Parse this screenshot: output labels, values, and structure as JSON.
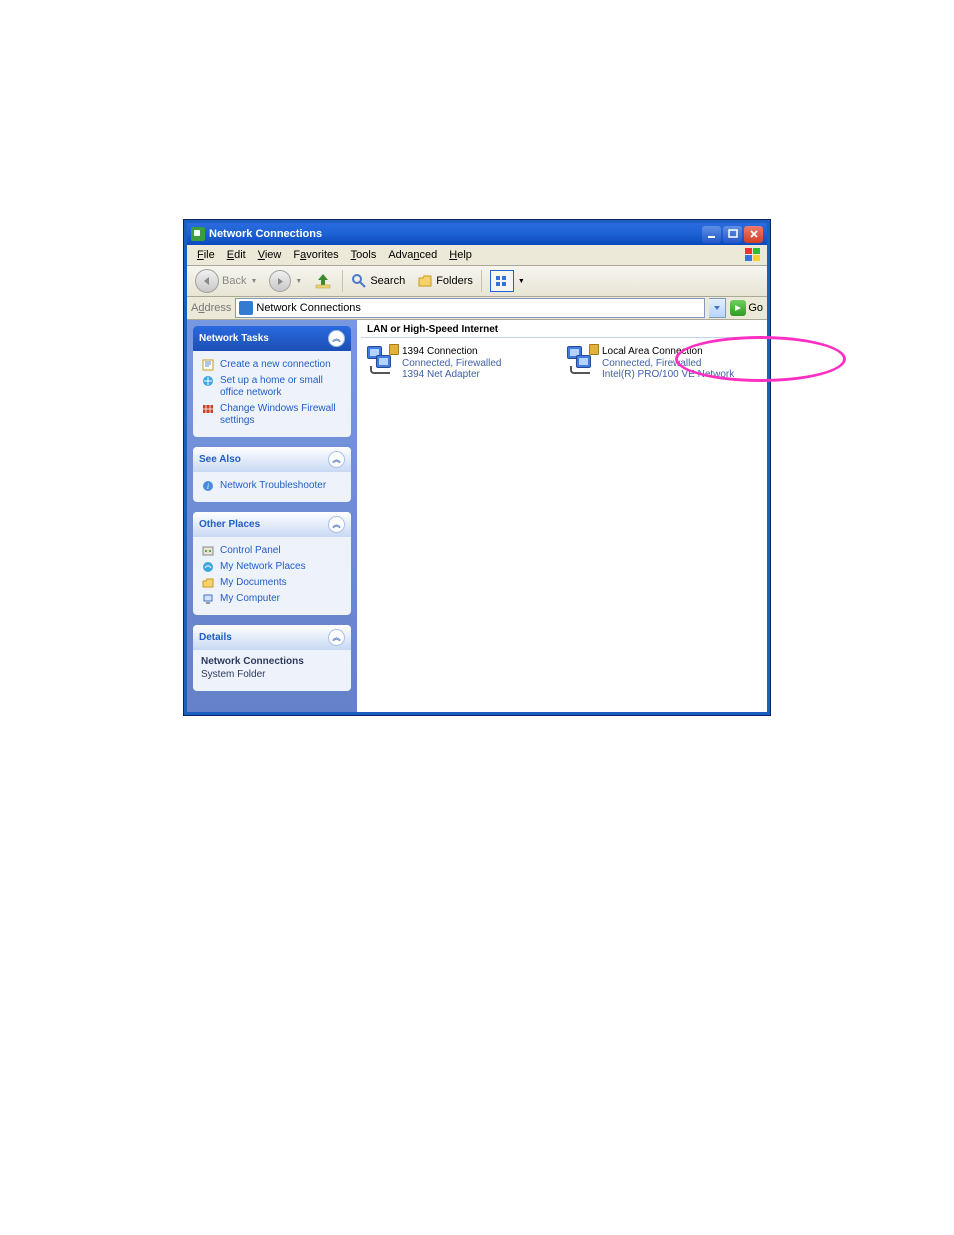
{
  "window": {
    "title": "Network Connections"
  },
  "menus": {
    "file": "File",
    "edit": "Edit",
    "view": "View",
    "favorites": "Favorites",
    "tools": "Tools",
    "advanced": "Advanced",
    "help": "Help"
  },
  "toolbar": {
    "back": "Back",
    "search": "Search",
    "folders": "Folders"
  },
  "address": {
    "label": "Address",
    "value": "Network Connections",
    "go": "Go"
  },
  "sidebar": {
    "tasks": {
      "title": "Network Tasks",
      "items": [
        "Create a new connection",
        "Set up a home or small office network",
        "Change Windows Firewall settings"
      ]
    },
    "seealso": {
      "title": "See Also",
      "items": [
        "Network Troubleshooter"
      ]
    },
    "places": {
      "title": "Other Places",
      "items": [
        "Control Panel",
        "My Network Places",
        "My Documents",
        "My Computer"
      ]
    },
    "details": {
      "title": "Details",
      "line1": "Network Connections",
      "line2": "System Folder"
    }
  },
  "content": {
    "group": "LAN or High-Speed Internet",
    "items": [
      {
        "title": "1394 Connection",
        "status": "Connected, Firewalled",
        "device": "1394 Net Adapter"
      },
      {
        "title": "Local Area Connection",
        "status": "Connected, Firewalled",
        "device": "Intel(R) PRO/100 VE Network"
      }
    ]
  }
}
